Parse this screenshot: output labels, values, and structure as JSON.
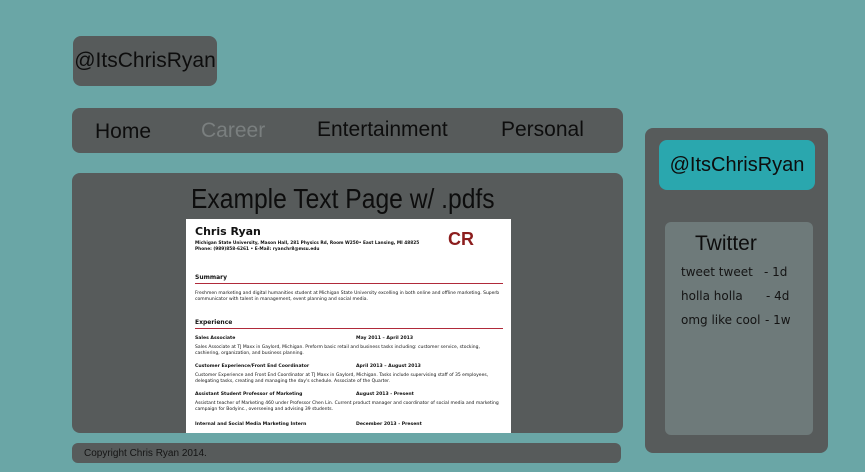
{
  "header": {
    "logo_text": "@ItsChrisRyan"
  },
  "nav": {
    "items": [
      {
        "label": "Home",
        "active": false
      },
      {
        "label": "Career",
        "active": true
      },
      {
        "label": "Entertainment",
        "active": false
      },
      {
        "label": "Personal",
        "active": false
      }
    ]
  },
  "main": {
    "heading": "Example Text Page w/ .pdfs",
    "pdf": {
      "name": "Chris Ryan",
      "address": "Michigan State University, Mason Hall, 281 Physics Rd, Room W250• East Lansing, MI 48825",
      "contact": "Phone: (989)858-6261 • E-Mail: ryanchr8@msu.edu",
      "monogram": "CR",
      "summary_title": "Summary",
      "summary_text": "Freshmen marketing and digital humanities student at Michigan State University excelling in both online and offline marketing. Superb communicator with talent in management, event planning and social media.",
      "experience_title": "Experience",
      "jobs": [
        {
          "title": "Sales Associate",
          "dates": "May 2011 – April 2013",
          "desc": "Sales Associate at TJ Maxx in Gaylord, Michigan. Preform basic retail and business tasks including: customer service, stocking, cashiering, organization, and business planning."
        },
        {
          "title": "Customer Experience/Front End Coordinator",
          "dates": "April 2013 – August 2013",
          "desc": "Customer Experience and Front End Coordinator at TJ Maxx in Gaylord, Michigan. Tasks include supervising staff of 35 employees, delegating tasks, creating and managing the day's schedule. Associate of the Quarter."
        },
        {
          "title": "Assistant Student Professor of Marketing",
          "dates": "August 2013 - Present",
          "desc": "Assistant teacher of Marketing 460 under Professor Chen Lin. Current product manager and coordinator of social media and marketing campaign for Bodyinc., overseeing and advising 39 students."
        },
        {
          "title": "Internal and Social Media Marketing Intern",
          "dates": "December 2013 - Present",
          "desc": ""
        }
      ]
    }
  },
  "footer": {
    "copyright": "Copyright Chris Ryan 2014."
  },
  "sidebar": {
    "handle": "@ItsChrisRyan",
    "twitter_title": "Twitter",
    "tweets": [
      {
        "text": "tweet tweet",
        "ago": "- 1d"
      },
      {
        "text": "holla holla",
        "ago": "- 4d"
      },
      {
        "text": "omg like cool",
        "ago": "- 1w"
      }
    ]
  },
  "colors": {
    "background": "#6aa6a6",
    "panel": "#575b5b",
    "accent": "#2aa7ae",
    "resume_rule": "#b02a3a",
    "monogram": "#8c1d1d"
  }
}
